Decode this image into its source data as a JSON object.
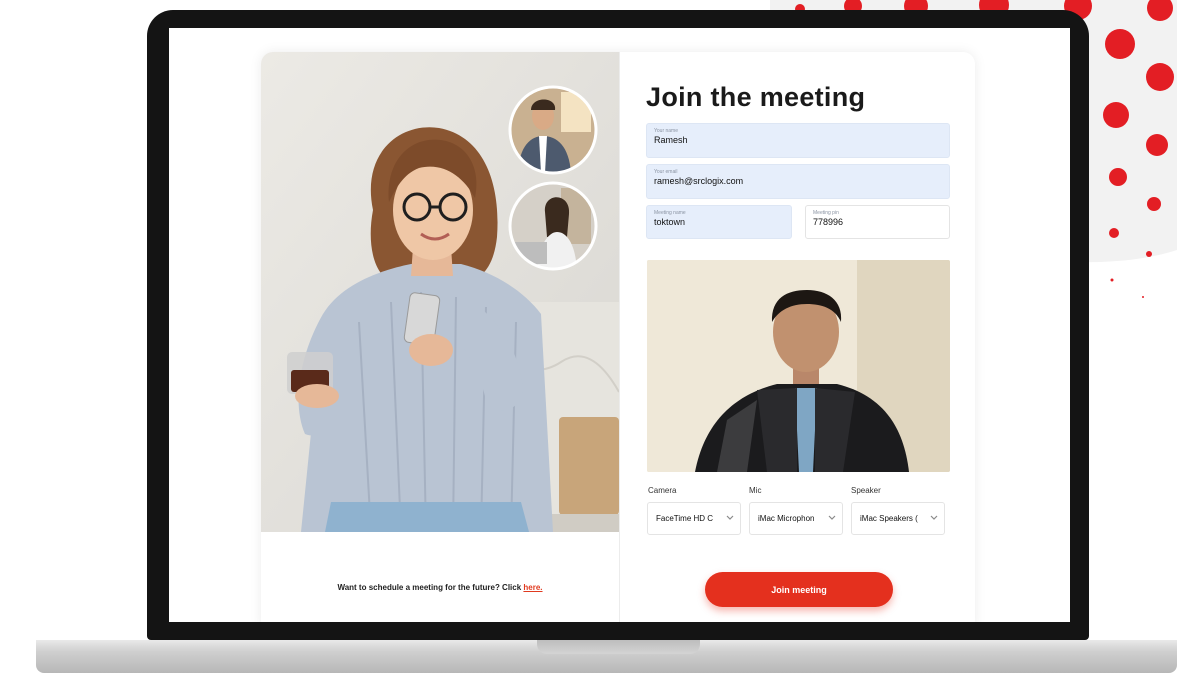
{
  "colors": {
    "accent": "#e4301e",
    "field_bg": "#e6eefb",
    "link": "#e03a1f"
  },
  "form": {
    "title": "Join the meeting",
    "name": {
      "label": "Your name",
      "value": "Ramesh"
    },
    "email": {
      "label": "Your email",
      "value": "ramesh@srclogix.com"
    },
    "meeting_name": {
      "label": "Meeting name",
      "value": "toktown"
    },
    "meeting_pin": {
      "label": "Meeting pin",
      "value": "778996"
    }
  },
  "devices": {
    "camera": {
      "label": "Camera",
      "value": "FaceTime HD C"
    },
    "mic": {
      "label": "Mic",
      "value": "iMac Microphon"
    },
    "speaker": {
      "label": "Speaker",
      "value": "iMac Speakers ("
    }
  },
  "actions": {
    "join_label": "Join meeting"
  },
  "schedule": {
    "text": "Want to schedule a meeting for the future? Click ",
    "link": "here."
  },
  "icons": {
    "select_arrow": "chevron-down-icon"
  }
}
